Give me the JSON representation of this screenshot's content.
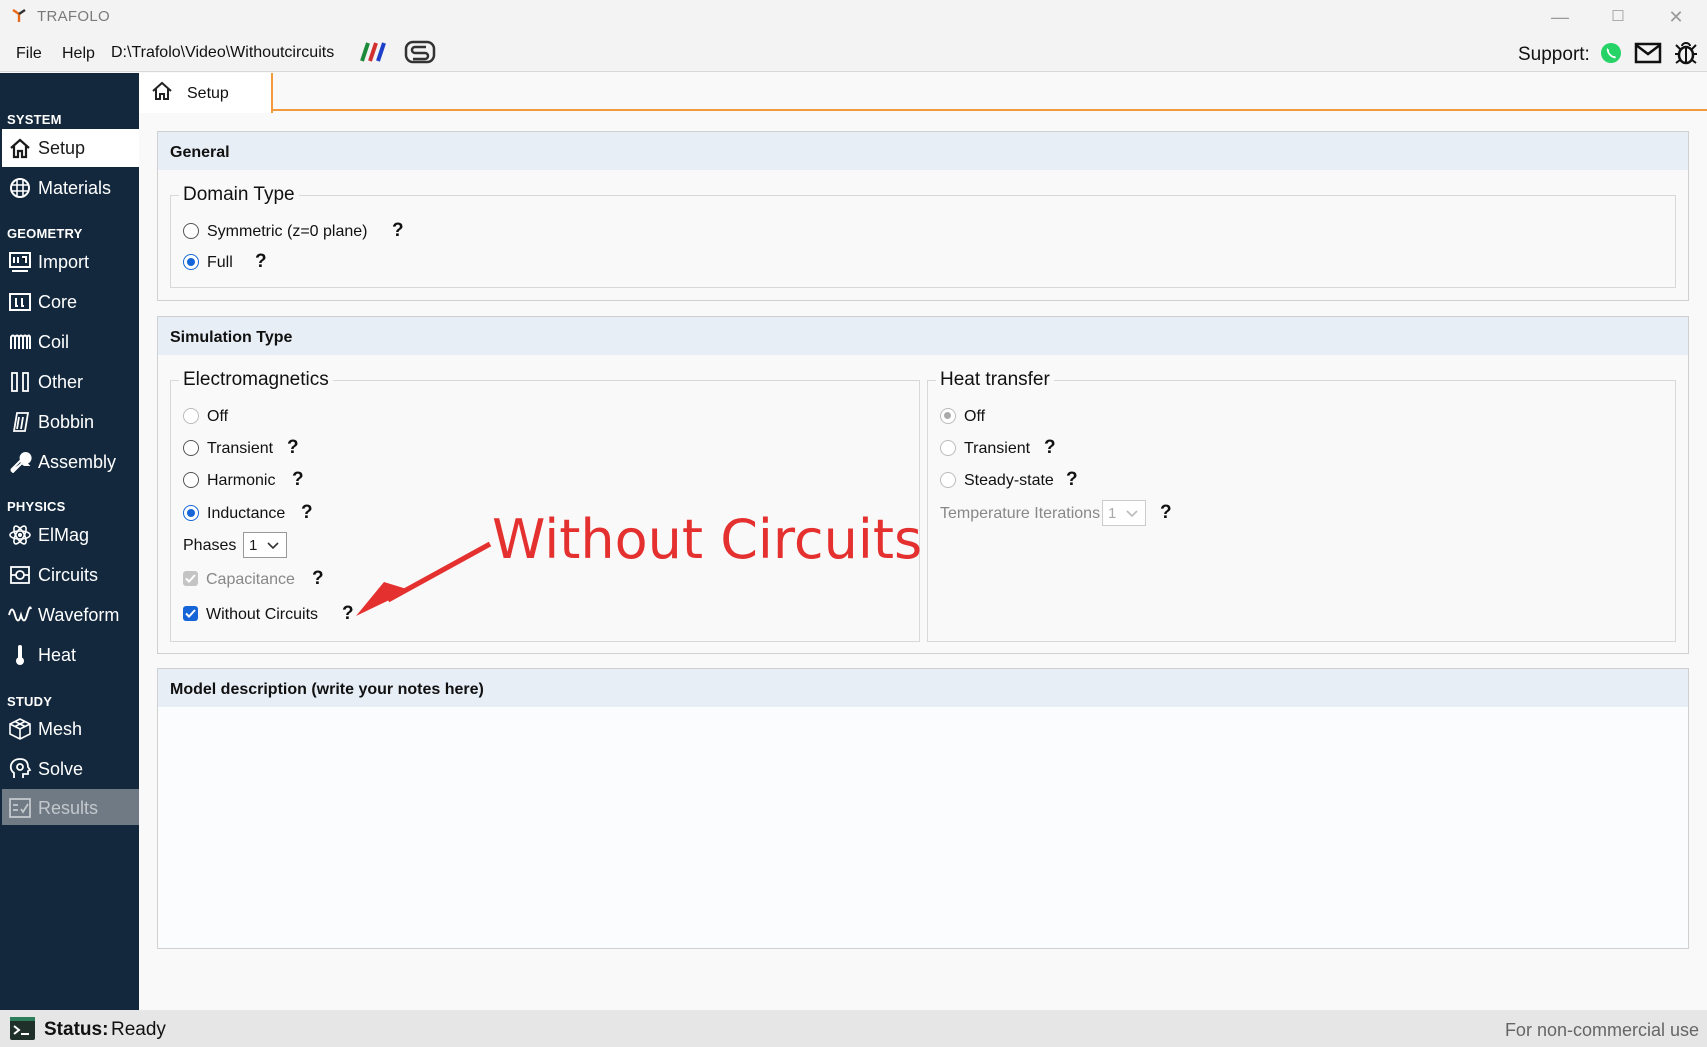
{
  "window": {
    "title": "TRAFOLO",
    "minimize": "—",
    "maximize": "☐",
    "close": "✕"
  },
  "menu": {
    "file": "File",
    "help": "Help",
    "path": "D:\\Trafolo\\Video\\Withoutcircuits",
    "support_label": "Support:"
  },
  "sidebar": {
    "sections": {
      "system": "SYSTEM",
      "geometry": "GEOMETRY",
      "physics": "PHYSICS",
      "study": "STUDY"
    },
    "items": {
      "setup": "Setup",
      "materials": "Materials",
      "import": "Import",
      "core": "Core",
      "coil": "Coil",
      "other": "Other",
      "bobbin": "Bobbin",
      "assembly": "Assembly",
      "elmag": "ElMag",
      "circuits": "Circuits",
      "waveform": "Waveform",
      "heat": "Heat",
      "mesh": "Mesh",
      "solve": "Solve",
      "results": "Results"
    }
  },
  "tab": {
    "label": "Setup"
  },
  "general": {
    "title": "General",
    "domain_type": {
      "title": "Domain Type",
      "symmetric": "Symmetric (z=0 plane)",
      "full": "Full",
      "selected": "full"
    }
  },
  "simulation": {
    "title": "Simulation Type",
    "electromagnetics": {
      "title": "Electromagnetics",
      "off": "Off",
      "transient": "Transient",
      "harmonic": "Harmonic",
      "inductance": "Inductance",
      "selected": "inductance",
      "phases_label": "Phases",
      "phases_value": "1",
      "capacitance": "Capacitance",
      "capacitance_checked": true,
      "without_circuits": "Without Circuits",
      "without_circuits_checked": true
    },
    "heat": {
      "title": "Heat transfer",
      "off": "Off",
      "transient": "Transient",
      "steady": "Steady-state",
      "selected": "off",
      "temp_iter_label": "Temperature Iterations",
      "temp_iter_value": "1"
    }
  },
  "model_description": {
    "title": "Model description (write your notes here)",
    "value": ""
  },
  "help_mark": "?",
  "annotation": {
    "text": "Without Circuits",
    "color": "#e53030"
  },
  "status": {
    "key": "Status:",
    "value": "Ready",
    "right": "For non-commercial use"
  },
  "colors": {
    "sidebar": "#13283d",
    "accent": "#f39a3c",
    "radio": "#1565d8",
    "panel_head": "#e8eef6"
  }
}
